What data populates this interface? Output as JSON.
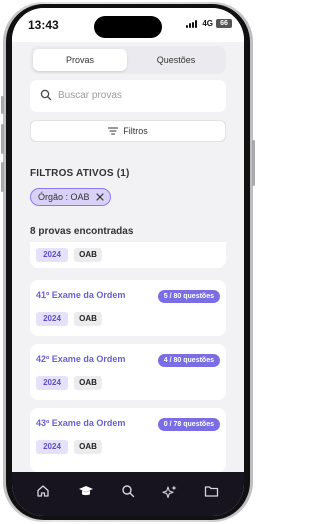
{
  "status_bar": {
    "time": "13:43",
    "network": "4G",
    "battery": "66"
  },
  "segments": {
    "active": "Provas",
    "inactive": "Questões"
  },
  "search": {
    "placeholder": "Buscar provas"
  },
  "filters_button": {
    "label": "Filtros"
  },
  "active_filters": {
    "title": "FILTROS ATIVOS (1)",
    "chip_label": "Órgão : OAB"
  },
  "results_count": "8 provas encontradas",
  "cards": [
    {
      "title": "",
      "progress": "",
      "year": "2024",
      "org": "OAB"
    },
    {
      "title": "41º Exame da Ordem",
      "progress": "5 / 80 questões",
      "year": "2024",
      "org": "OAB"
    },
    {
      "title": "42º Exame da Ordem",
      "progress": "4 / 80 questões",
      "year": "2024",
      "org": "OAB"
    },
    {
      "title": "43º Exame da Ordem",
      "progress": "0 / 78 questões",
      "year": "2024",
      "org": "OAB"
    }
  ],
  "tab_bar": {
    "items": [
      "home-icon",
      "graduation-cap-icon",
      "search-icon",
      "sparkles-icon",
      "folder-icon"
    ],
    "active_index": 1
  },
  "colors": {
    "accent": "#7b6ee5",
    "title": "#6a5fd8",
    "chip_bg": "#d9d2f6",
    "tab_bg": "#18141f"
  }
}
